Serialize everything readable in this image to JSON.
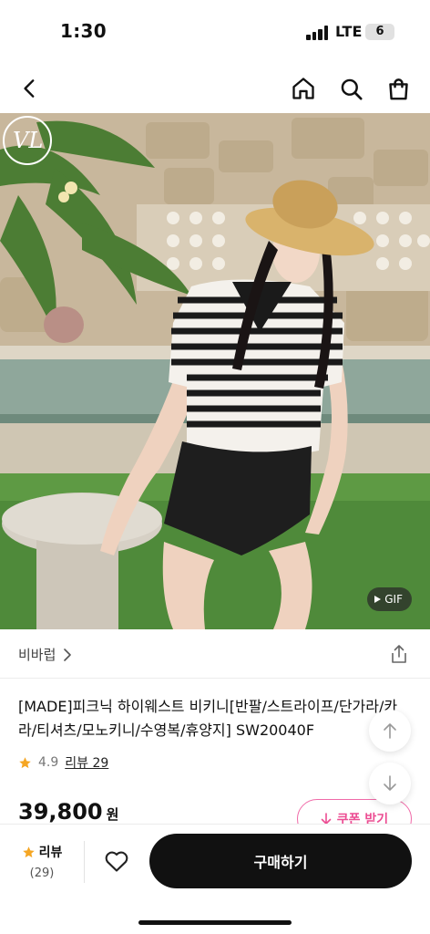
{
  "status_bar": {
    "time": "1:30",
    "network": "LTE",
    "battery": "6"
  },
  "nav": {
    "back_icon": "chevron-left-icon",
    "home_icon": "home-icon",
    "search_icon": "search-icon",
    "cart_icon": "shopping-bag-icon"
  },
  "hero": {
    "badge": "GIF",
    "logo_text": "VL"
  },
  "brand": {
    "name": "비바럽",
    "chevron": "›"
  },
  "product": {
    "title": "[MADE]피크닉 하이웨스트 비키니[반팔/스트라이프/단가라/카라/티셔츠/모노키니/수영복/휴양지] SW20040F",
    "rating": "4.9",
    "review_link": "리뷰 29",
    "price": "39,800",
    "currency": "원"
  },
  "coupon": {
    "label": "쿠폰 받기"
  },
  "bottom_bar": {
    "review_label": "리뷰",
    "review_count": "(29)",
    "buy_label": "구매하기"
  },
  "colors": {
    "star": "#f5a623",
    "coupon": "#ec4d93",
    "buy_button": "#111111"
  }
}
